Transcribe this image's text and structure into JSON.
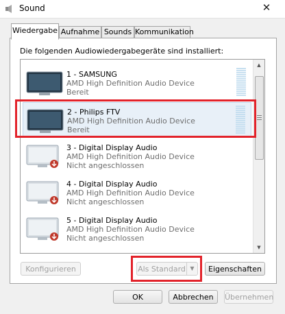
{
  "window": {
    "title": "Sound",
    "close_glyph": "✕"
  },
  "tabs": [
    {
      "label": "Wiedergabe",
      "active": true
    },
    {
      "label": "Aufnahme",
      "active": false
    },
    {
      "label": "Sounds",
      "active": false
    },
    {
      "label": "Kommunikation",
      "active": false
    }
  ],
  "instruction": "Die folgenden Audiowiedergabegeräte sind installiert:",
  "devices": [
    {
      "name": "1 - SAMSUNG",
      "description": "AMD High Definition Audio Device",
      "status": "Bereit",
      "connected": true
    },
    {
      "name": "2 - Philips FTV",
      "description": "AMD High Definition Audio Device",
      "status": "Bereit",
      "connected": true,
      "selected": true
    },
    {
      "name": "3 - Digital Display Audio",
      "description": "AMD High Definition Audio Device",
      "status": "Nicht angeschlossen",
      "connected": false
    },
    {
      "name": "4 - Digital Display Audio",
      "description": "AMD High Definition Audio Device",
      "status": "Nicht angeschlossen",
      "connected": false
    },
    {
      "name": "5 - Digital Display Audio",
      "description": "AMD High Definition Audio Device",
      "status": "Nicht angeschlossen",
      "connected": false
    }
  ],
  "buttons": {
    "configure": "Konfigurieren",
    "set_default": "Als Standard",
    "properties": "Eigenschaften",
    "ok": "OK",
    "cancel": "Abbrechen",
    "apply": "Übernehmen"
  },
  "colors": {
    "highlight": "#e2222a",
    "level_meter": "#c6dff0",
    "disconnected_badge": "#c0392b"
  },
  "icons": {
    "title": "speaker-icon",
    "device": "monitor-icon",
    "disconnected": "down-arrow-badge-icon"
  }
}
